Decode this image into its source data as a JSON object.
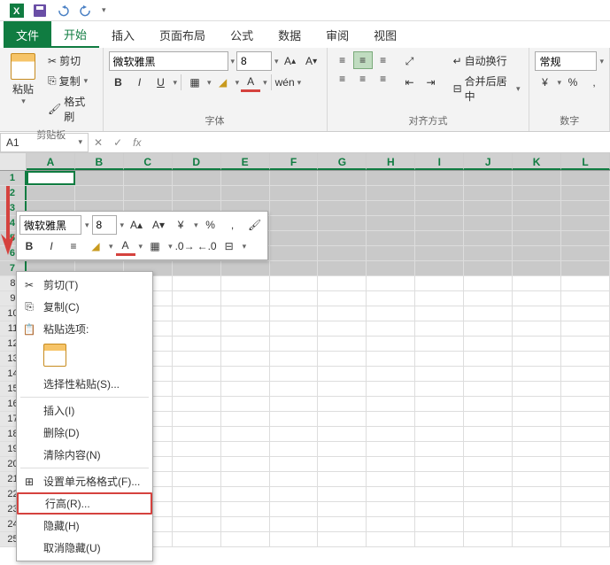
{
  "qat": {
    "tooltip_save": "保存",
    "tooltip_undo": "撤销",
    "tooltip_redo": "重做"
  },
  "tabs": {
    "file": "文件",
    "home": "开始",
    "insert": "插入",
    "layout": "页面布局",
    "formulas": "公式",
    "data": "数据",
    "review": "审阅",
    "view": "视图"
  },
  "ribbon": {
    "clipboard": {
      "paste": "粘贴",
      "cut": "剪切",
      "copy": "复制",
      "painter": "格式刷",
      "group": "剪贴板"
    },
    "font": {
      "name": "微软雅黑",
      "size": "8",
      "group": "字体",
      "wen": "wén"
    },
    "alignment": {
      "wrap": "自动换行",
      "merge": "合并后居中",
      "group": "对齐方式"
    },
    "number": {
      "general": "常规",
      "group": "数字",
      "percent": "%"
    }
  },
  "namebox": "A1",
  "fx": "fx",
  "columns": [
    "A",
    "B",
    "C",
    "D",
    "E",
    "F",
    "G",
    "H",
    "I",
    "J",
    "K",
    "L"
  ],
  "rows": [
    1,
    2,
    3,
    4,
    5,
    6,
    7,
    8,
    9,
    10,
    11,
    12,
    13,
    14,
    15,
    16,
    17,
    18,
    19,
    20,
    21,
    22,
    23,
    24,
    25
  ],
  "minitoolbar": {
    "font": "微软雅黑",
    "size": "8",
    "percent": "%",
    "comma": ","
  },
  "contextmenu": {
    "cut": "剪切(T)",
    "copy": "复制(C)",
    "paste_options": "粘贴选项:",
    "paste_special": "选择性粘贴(S)...",
    "insert": "插入(I)",
    "delete": "删除(D)",
    "clear": "清除内容(N)",
    "format_cells": "设置单元格格式(F)...",
    "row_height": "行高(R)...",
    "hide": "隐藏(H)",
    "unhide": "取消隐藏(U)"
  }
}
